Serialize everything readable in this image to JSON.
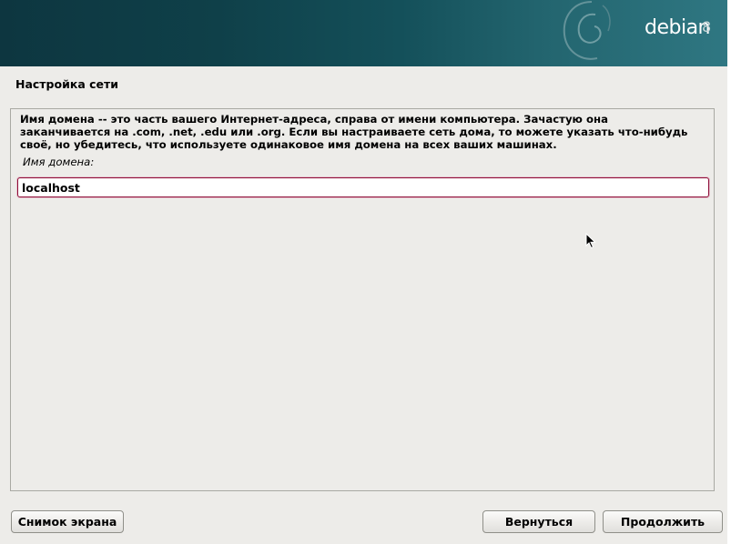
{
  "header": {
    "brand": "debian",
    "version": "8"
  },
  "step": {
    "title": "Настройка сети"
  },
  "form": {
    "description": "Имя домена -- это часть вашего Интернет-адреса, справа от имени компьютера. Зачастую она заканчивается на .com, .net, .edu или .org. Если вы настраиваете сеть дома, то можете указать что-нибудь своё, но убедитесь, что используете одинаковое имя домена на всех ваших машинах.",
    "field_label": "Имя домена:",
    "field_value": "localhost"
  },
  "buttons": {
    "screenshot": "Снимок экрана",
    "back": "Вернуться",
    "continue": "Продолжить"
  },
  "colors": {
    "banner_dark": "#0d3640",
    "banner_light": "#2f7782",
    "input_border": "#8c0c36",
    "background": "#edece9"
  },
  "icons": {
    "logo": "debian-swirl-icon",
    "pointer": "mouse-pointer-icon"
  }
}
